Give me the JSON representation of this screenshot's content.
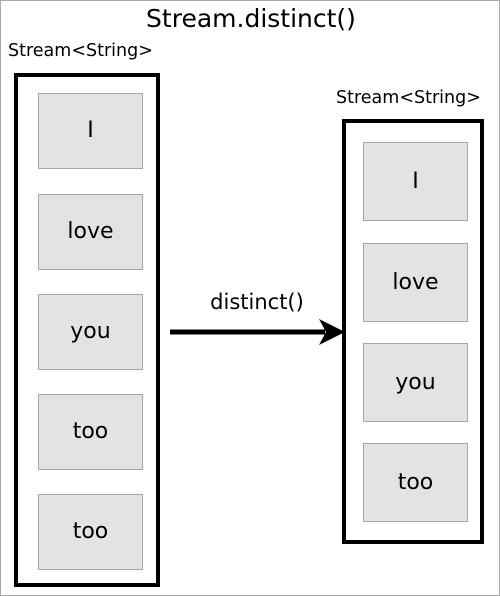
{
  "diagram": {
    "title": "Stream.distinct()",
    "source": {
      "type_label": "Stream<String>",
      "items": [
        "I",
        "love",
        "you",
        "too",
        "too"
      ]
    },
    "operation": {
      "label": "distinct()",
      "arrow_icon": "right-arrow-icon"
    },
    "result": {
      "type_label": "Stream<String>",
      "items": [
        "I",
        "love",
        "you",
        "too"
      ]
    },
    "colors": {
      "item_fill": "#e3e3e3",
      "item_border": "#a6a6a6",
      "container_border": "#000000",
      "background": "#ffffff",
      "text": "#000000"
    }
  }
}
